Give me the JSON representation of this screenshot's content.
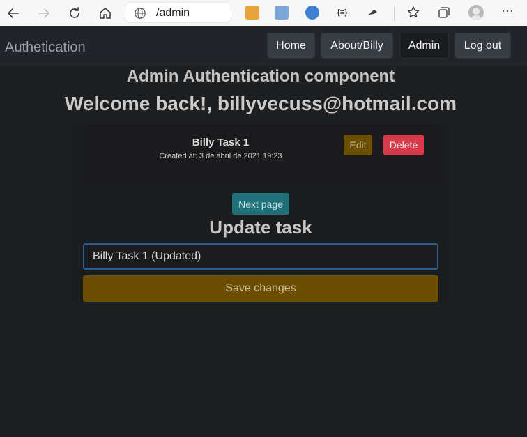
{
  "browser": {
    "address_url": "/admin",
    "icons": [
      "back-icon",
      "forward-icon",
      "refresh-icon",
      "home-icon",
      "globe-icon",
      "translate-icon",
      "translate-alt-icon",
      "extension-blue-icon",
      "json-icon",
      "reader-icon",
      "favorites-icon",
      "collections-icon",
      "profile-icon",
      "more-icon"
    ]
  },
  "navbar": {
    "brand": "Authetication",
    "items": [
      {
        "label": "Home"
      },
      {
        "label": "About/Billy"
      },
      {
        "label": "Admin"
      },
      {
        "label": "Log out"
      }
    ]
  },
  "main": {
    "component_title": "Admin Authentication component",
    "welcome": "Welcome back!, billyvecuss@hotmail.com",
    "task": {
      "title": "Billy Task 1",
      "created": "Created at: 3 de abril de 2021 19:23",
      "edit_label": "Edit",
      "delete_label": "Delete"
    },
    "next_page_label": "Next page",
    "update_title": "Update task",
    "task_input_value": "Billy Task 1 (Updated)",
    "save_label": "Save changes"
  },
  "colors": {
    "background": "#1e1f21",
    "navbar": "#212428",
    "warning": "#6b4e00",
    "danger": "#d8394b",
    "info": "#1f7079"
  }
}
